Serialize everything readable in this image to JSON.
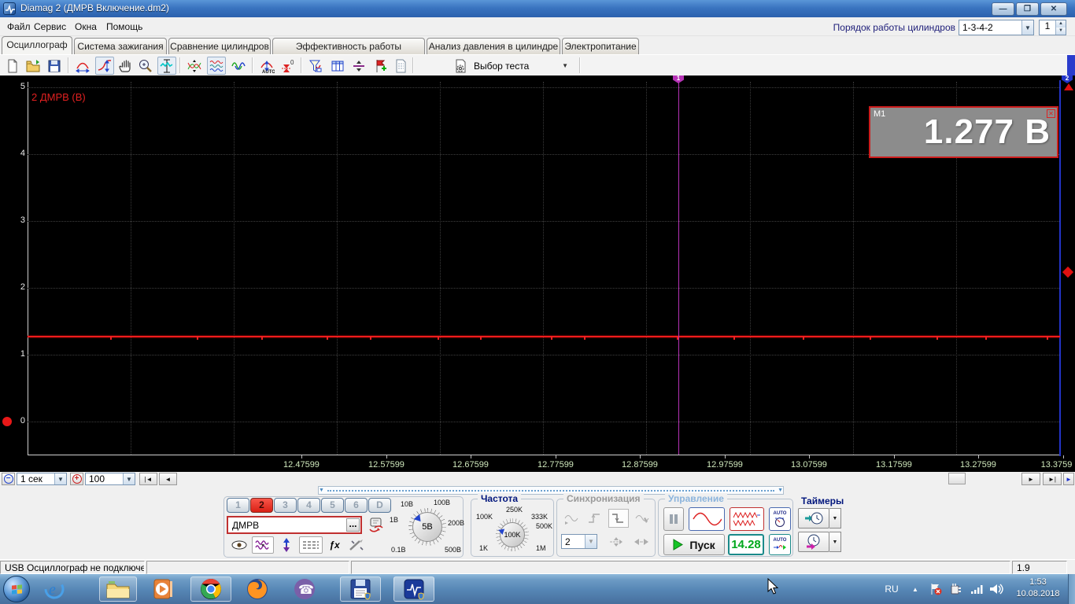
{
  "window": {
    "title": "Diamag 2 (ДМРВ Включение.dm2)"
  },
  "menubar": {
    "items": [
      "Файл",
      "Сервис",
      "Окна",
      "Помощь"
    ],
    "cylinder_order": {
      "label": "Порядок работы цилиндров",
      "value": "1-3-4-2",
      "counter": "1"
    }
  },
  "tabs": [
    {
      "label": "Осциллограф"
    },
    {
      "label": "Система зажигания"
    },
    {
      "label": "Сравнение цилиндров"
    },
    {
      "label": "Эффективность работы цилиндров"
    },
    {
      "label": "Анализ давления в цилиндре"
    },
    {
      "label": "Электропитание"
    }
  ],
  "toolbar": {
    "test_select": "Выбор теста"
  },
  "scope": {
    "channel_label": "2 ДМРВ (В)",
    "marker1": "1",
    "marker2": "2",
    "measurement": {
      "name": "M1",
      "value": "1.277 В",
      "close": "✕"
    },
    "y_ticks": [
      "5",
      "4",
      "3",
      "2",
      "1",
      "0"
    ],
    "x_ticks": [
      "12.47599",
      "12.57599",
      "12.67599",
      "12.77599",
      "12.87599",
      "12.97599",
      "13.07599",
      "13.17599",
      "13.27599",
      "13.3759"
    ],
    "trace_constant_volts": 1.277
  },
  "transport": {
    "time_scale": "1 сек",
    "sweep": "100"
  },
  "panel": {
    "channels": {
      "buttons": [
        "1",
        "2",
        "3",
        "4",
        "5",
        "6",
        "D"
      ],
      "active": "2"
    },
    "channel_name": {
      "value": "ДМРВ",
      "more": "..."
    },
    "fx_label": "ƒx",
    "volts_knob": {
      "value": "5В",
      "labels": [
        "10В",
        "100В",
        "1В",
        "200В",
        "0.1В",
        "500В"
      ]
    },
    "frequency": {
      "title": "Частота",
      "value": "100K",
      "labels": [
        "250K",
        "100K",
        "333K",
        "500K",
        "1K",
        "1M"
      ]
    },
    "sync": {
      "title": "Синхронизация",
      "channel": "2"
    },
    "control": {
      "title": "Управление",
      "start": "Пуск",
      "display": "14.28",
      "auto1": "AUTO",
      "auto2": "AUTO"
    },
    "timers": {
      "title": "Таймеры"
    }
  },
  "statusbar": {
    "message": "USB Осциллограф не подключен",
    "value": "1.9"
  },
  "taskbar": {
    "lang": "RU",
    "time": "1:53",
    "date": "10.08.2018"
  }
}
